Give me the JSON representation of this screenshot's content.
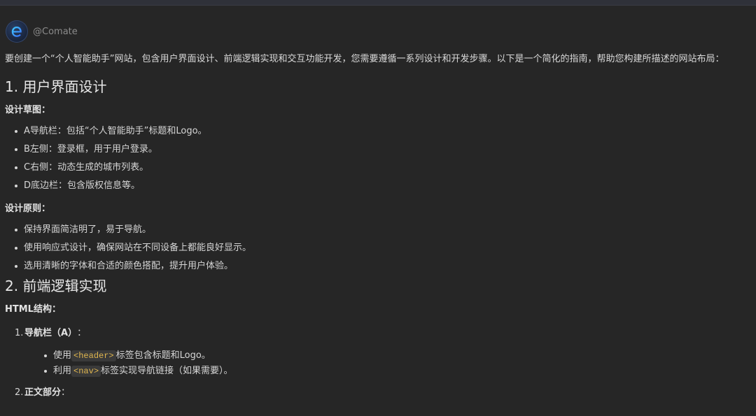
{
  "header": {
    "author": "@Comate",
    "avatar_icon": "comate-logo-icon"
  },
  "intro": "要创建一个“个人智能助手”网站，包含用户界面设计、前端逻辑实现和交互功能开发，您需要遵循一系列设计和开发步骤。以下是一个简化的指南，帮助您构建所描述的网站布局：",
  "section1": {
    "title": "1. 用户界面设计",
    "sketch_label": "设计草图：",
    "sketch_items": [
      "A导航栏：包括“个人智能助手”标题和Logo。",
      "B左侧：登录框，用于用户登录。",
      "C右侧：动态生成的城市列表。",
      "D底边栏：包含版权信息等。"
    ],
    "principles_label": "设计原则：",
    "principles_items": [
      "保持界面简洁明了，易于导航。",
      "使用响应式设计，确保网站在不同设备上都能良好显示。",
      "选用清晰的字体和合适的颜色搭配，提升用户体验。"
    ]
  },
  "section2": {
    "title": "2. 前端逻辑实现",
    "html_label": "HTML结构：",
    "steps": [
      {
        "num": "1.",
        "title": "导航栏（A）",
        "suffix": "：",
        "subs": [
          {
            "pre": "使用",
            "code": "<header>",
            "post": "标签包含标题和Logo。"
          },
          {
            "pre": "利用",
            "code": "<nav>",
            "post": "标签实现导航链接（如果需要）。"
          }
        ]
      },
      {
        "num": "2.",
        "title": "正文部分",
        "suffix": "："
      }
    ]
  },
  "colors": {
    "background": "#262626",
    "text": "#d6d6d6",
    "code_text": "#e0b64f",
    "code_bg": "#3a3a3a"
  }
}
